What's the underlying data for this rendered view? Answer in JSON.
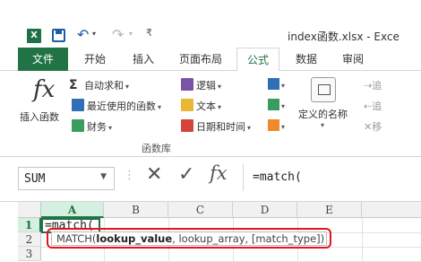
{
  "quick_access": {
    "app_icon": "X",
    "icons": [
      "excel-icon",
      "save-icon",
      "undo-icon",
      "redo-icon",
      "customize-caret-icon"
    ]
  },
  "window": {
    "title": "index函数.xlsx - Exce"
  },
  "tabs": [
    {
      "label": "文件"
    },
    {
      "label": "开始"
    },
    {
      "label": "插入"
    },
    {
      "label": "页面布局"
    },
    {
      "label": "公式"
    },
    {
      "label": "数据"
    },
    {
      "label": "审阅"
    }
  ],
  "ribbon": {
    "insert_function": {
      "icon": "fx",
      "label": "插入函数"
    },
    "col1": [
      {
        "label": "自动求和",
        "icon": "sigma-icon"
      },
      {
        "label": "最近使用的函数",
        "icon": "star-icon"
      },
      {
        "label": "财务",
        "icon": "finance-icon"
      }
    ],
    "col2": [
      {
        "label": "逻辑",
        "icon": "logic-icon"
      },
      {
        "label": "文本",
        "icon": "text-icon"
      },
      {
        "label": "日期和时间",
        "icon": "datetime-icon"
      }
    ],
    "col3_icons": [
      "lookup-icon",
      "math-icon",
      "more-functions-icon"
    ],
    "group_label": "函数库",
    "define_name": {
      "label": "定义的名称"
    },
    "trace": [
      "追",
      "追",
      "移"
    ]
  },
  "formula_bar": {
    "name_box": "SUM",
    "cancel_glyph": "✕",
    "enter_glyph": "✓",
    "fx_glyph": "fx",
    "formula": "=match("
  },
  "grid": {
    "columns": [
      "A",
      "B",
      "C",
      "D",
      "E"
    ],
    "rows": [
      "1",
      "2",
      "3"
    ],
    "active_cell_text": "=match(",
    "tooltip": {
      "prefix": "MATCH(",
      "bold_arg": "lookup_value",
      "rest": ", lookup_array, [match_type])"
    }
  },
  "colors": {
    "accent": "#217346",
    "highlight": "#e3161c"
  }
}
